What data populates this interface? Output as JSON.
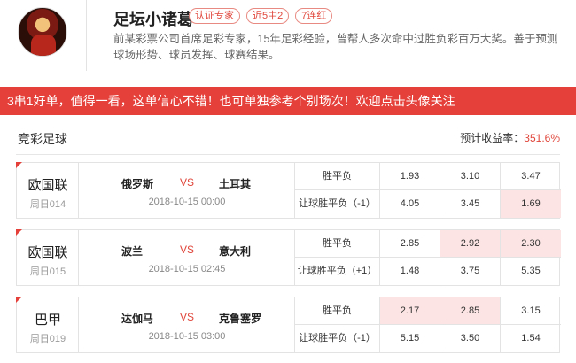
{
  "profile": {
    "name": "足坛小诸葛",
    "badges": [
      "认证专家",
      "近5中2",
      "7连红"
    ],
    "bio": "前某彩票公司首席足彩专家，15年足彩经验，曾帮人多次命中过胜负彩百万大奖。善于预测球场形势、球员发挥、球赛结果。"
  },
  "banner": "3串1好单，值得一看，这单信心不错！也可单独参考个别场次！欢迎点击头像关注",
  "section": {
    "title": "竞彩足球",
    "yield_label": "预计收益率：",
    "yield_value": "351.6%"
  },
  "matches": [
    {
      "league": "欧国联",
      "round": "周日014",
      "home": "俄罗斯",
      "vs": "VS",
      "away": "土耳其",
      "time": "2018-10-15 00:00",
      "market1": "胜平负",
      "odds1": [
        "1.93",
        "3.10",
        "3.47"
      ],
      "sel1": [
        false,
        false,
        false
      ],
      "market2": "让球胜平负（-1）",
      "odds2": [
        "4.05",
        "3.45",
        "1.69"
      ],
      "sel2": [
        false,
        false,
        true
      ]
    },
    {
      "league": "欧国联",
      "round": "周日015",
      "home": "波兰",
      "vs": "VS",
      "away": "意大利",
      "time": "2018-10-15 02:45",
      "market1": "胜平负",
      "odds1": [
        "2.85",
        "2.92",
        "2.30"
      ],
      "sel1": [
        false,
        true,
        true
      ],
      "market2": "让球胜平负（+1）",
      "odds2": [
        "1.48",
        "3.75",
        "5.35"
      ],
      "sel2": [
        false,
        false,
        false
      ]
    },
    {
      "league": "巴甲",
      "round": "周日019",
      "home": "达伽马",
      "vs": "VS",
      "away": "克鲁塞罗",
      "time": "2018-10-15 03:00",
      "market1": "胜平负",
      "odds1": [
        "2.17",
        "2.85",
        "3.15"
      ],
      "sel1": [
        true,
        true,
        false
      ],
      "market2": "让球胜平负（-1）",
      "odds2": [
        "5.15",
        "3.50",
        "1.54"
      ],
      "sel2": [
        false,
        false,
        false
      ]
    }
  ],
  "colors": {
    "accent": "#e5403a",
    "selected_bg": "#fbe4e3"
  }
}
